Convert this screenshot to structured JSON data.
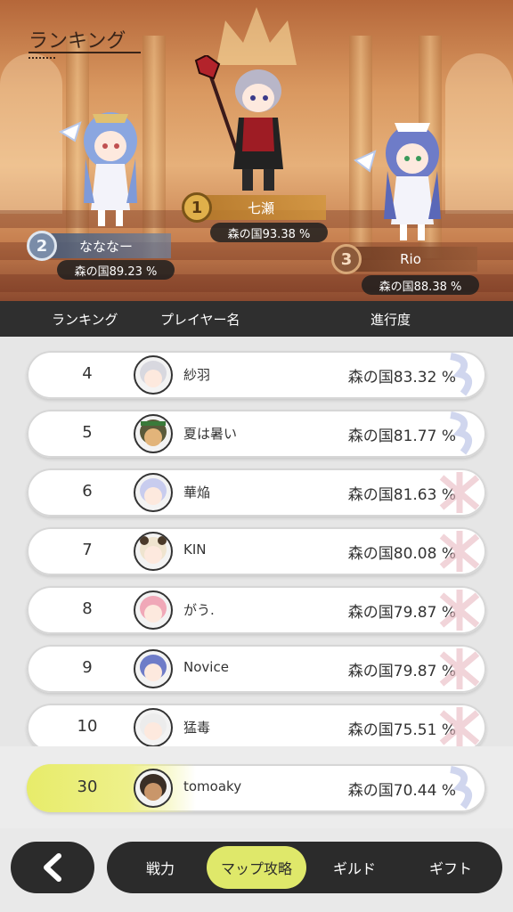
{
  "header": {
    "title": "ランキング"
  },
  "podium": [
    {
      "rank": "1",
      "name": "七瀬",
      "progress": "森の国93.38 %"
    },
    {
      "rank": "2",
      "name": "なななー",
      "progress": "森の国89.23 %"
    },
    {
      "rank": "3",
      "name": "Rio",
      "progress": "森の国88.38 %"
    }
  ],
  "columns": {
    "rank": "ランキング",
    "player": "プレイヤー名",
    "progress": "進行度"
  },
  "rows": [
    {
      "rank": "4",
      "name": "紗羽",
      "progress": "森の国83.32 %"
    },
    {
      "rank": "5",
      "name": "夏は暑い",
      "progress": "森の国81.77 %"
    },
    {
      "rank": "6",
      "name": "華焔",
      "progress": "森の国81.63 %"
    },
    {
      "rank": "7",
      "name": "KIN",
      "progress": "森の国80.08 %"
    },
    {
      "rank": "8",
      "name": "がう.",
      "progress": "森の国79.87 %"
    },
    {
      "rank": "9",
      "name": "Novice",
      "progress": "森の国79.87 %"
    },
    {
      "rank": "10",
      "name": "猛毒",
      "progress": "森の国75.51 %"
    }
  ],
  "my_row": {
    "rank": "30",
    "name": "tomoaky",
    "progress": "森の国70.44 %"
  },
  "nav": {
    "back_icon": "chevron-left-icon",
    "tabs": [
      {
        "label": "戦力",
        "active": false
      },
      {
        "label": "マップ攻略",
        "active": true
      },
      {
        "label": "ギルド",
        "active": false
      },
      {
        "label": "ギフト",
        "active": false
      }
    ]
  },
  "colors": {
    "accent": "#dfe86a",
    "dark": "#2b2b2b",
    "highlight": "#e7ec6a"
  }
}
